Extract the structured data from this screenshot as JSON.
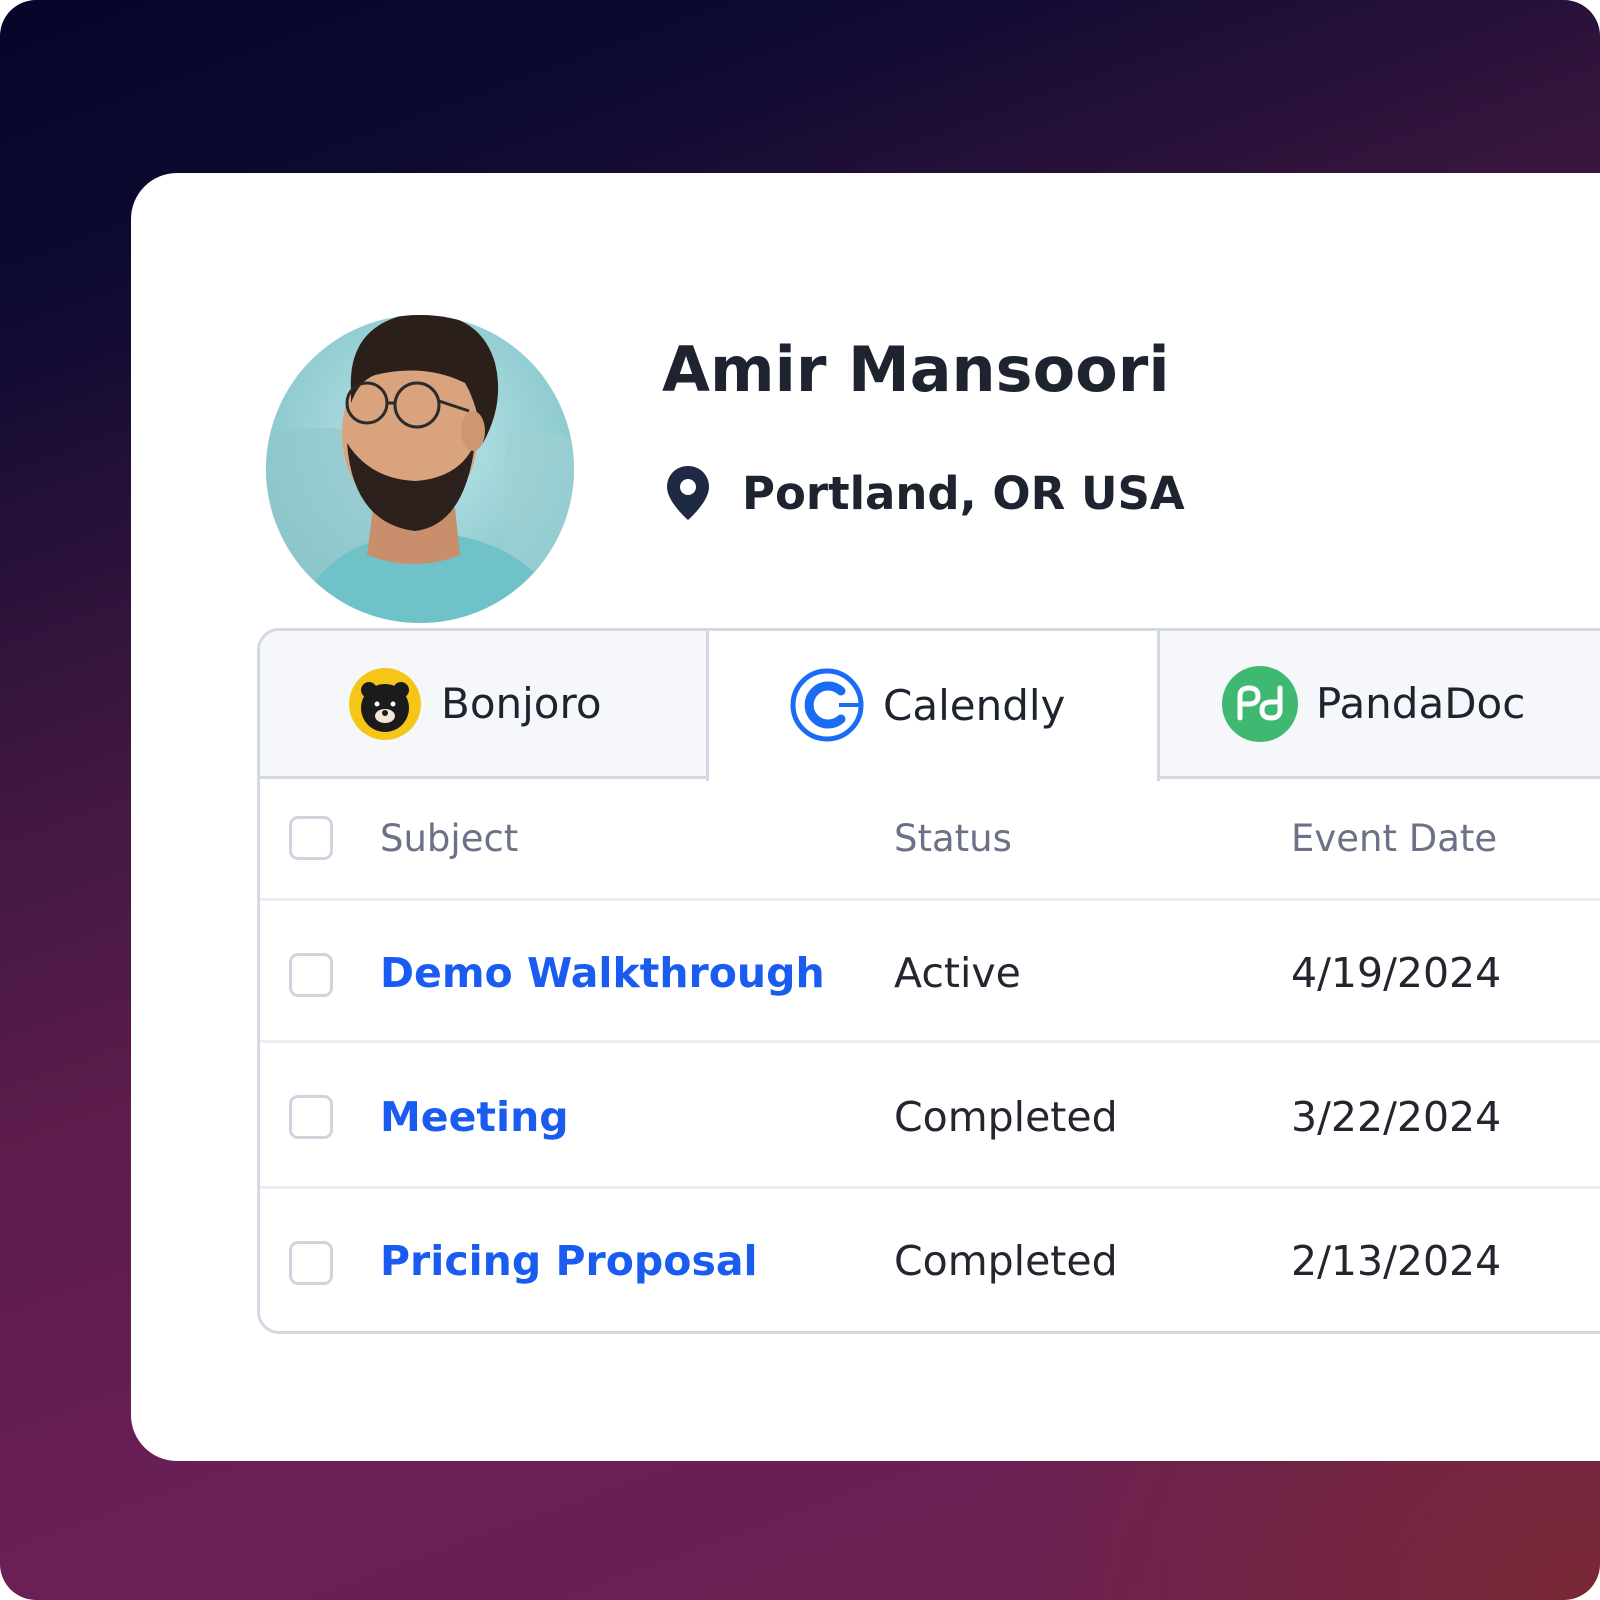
{
  "profile": {
    "name": "Amir Mansoori",
    "location": "Portland, OR USA",
    "location_icon": "map-pin-icon",
    "avatar": "profile-photo"
  },
  "tabs": [
    {
      "label": "Bonjoro",
      "icon": "bonjoro-logo",
      "active": false
    },
    {
      "label": "Calendly",
      "icon": "calendly-logo",
      "active": true
    },
    {
      "label": "PandaDoc",
      "icon": "pandadoc-logo",
      "active": false
    }
  ],
  "table": {
    "headers": [
      "Subject",
      "Status",
      "Event Date"
    ],
    "rows": [
      {
        "subject": "Demo Walkthrough",
        "status": "Active",
        "date": "4/19/2024"
      },
      {
        "subject": "Meeting",
        "status": "Completed",
        "date": "3/22/2024"
      },
      {
        "subject": "Pricing Proposal",
        "status": "Completed",
        "date": "2/13/2024"
      }
    ]
  },
  "colors": {
    "link": "#1a5cf0",
    "text": "#1e2330",
    "muted": "#6b7186",
    "border": "#d3d8e3",
    "calendly": "#1a6cf5",
    "pandadoc": "#3fb871",
    "bonjoro": "#f5c518"
  }
}
